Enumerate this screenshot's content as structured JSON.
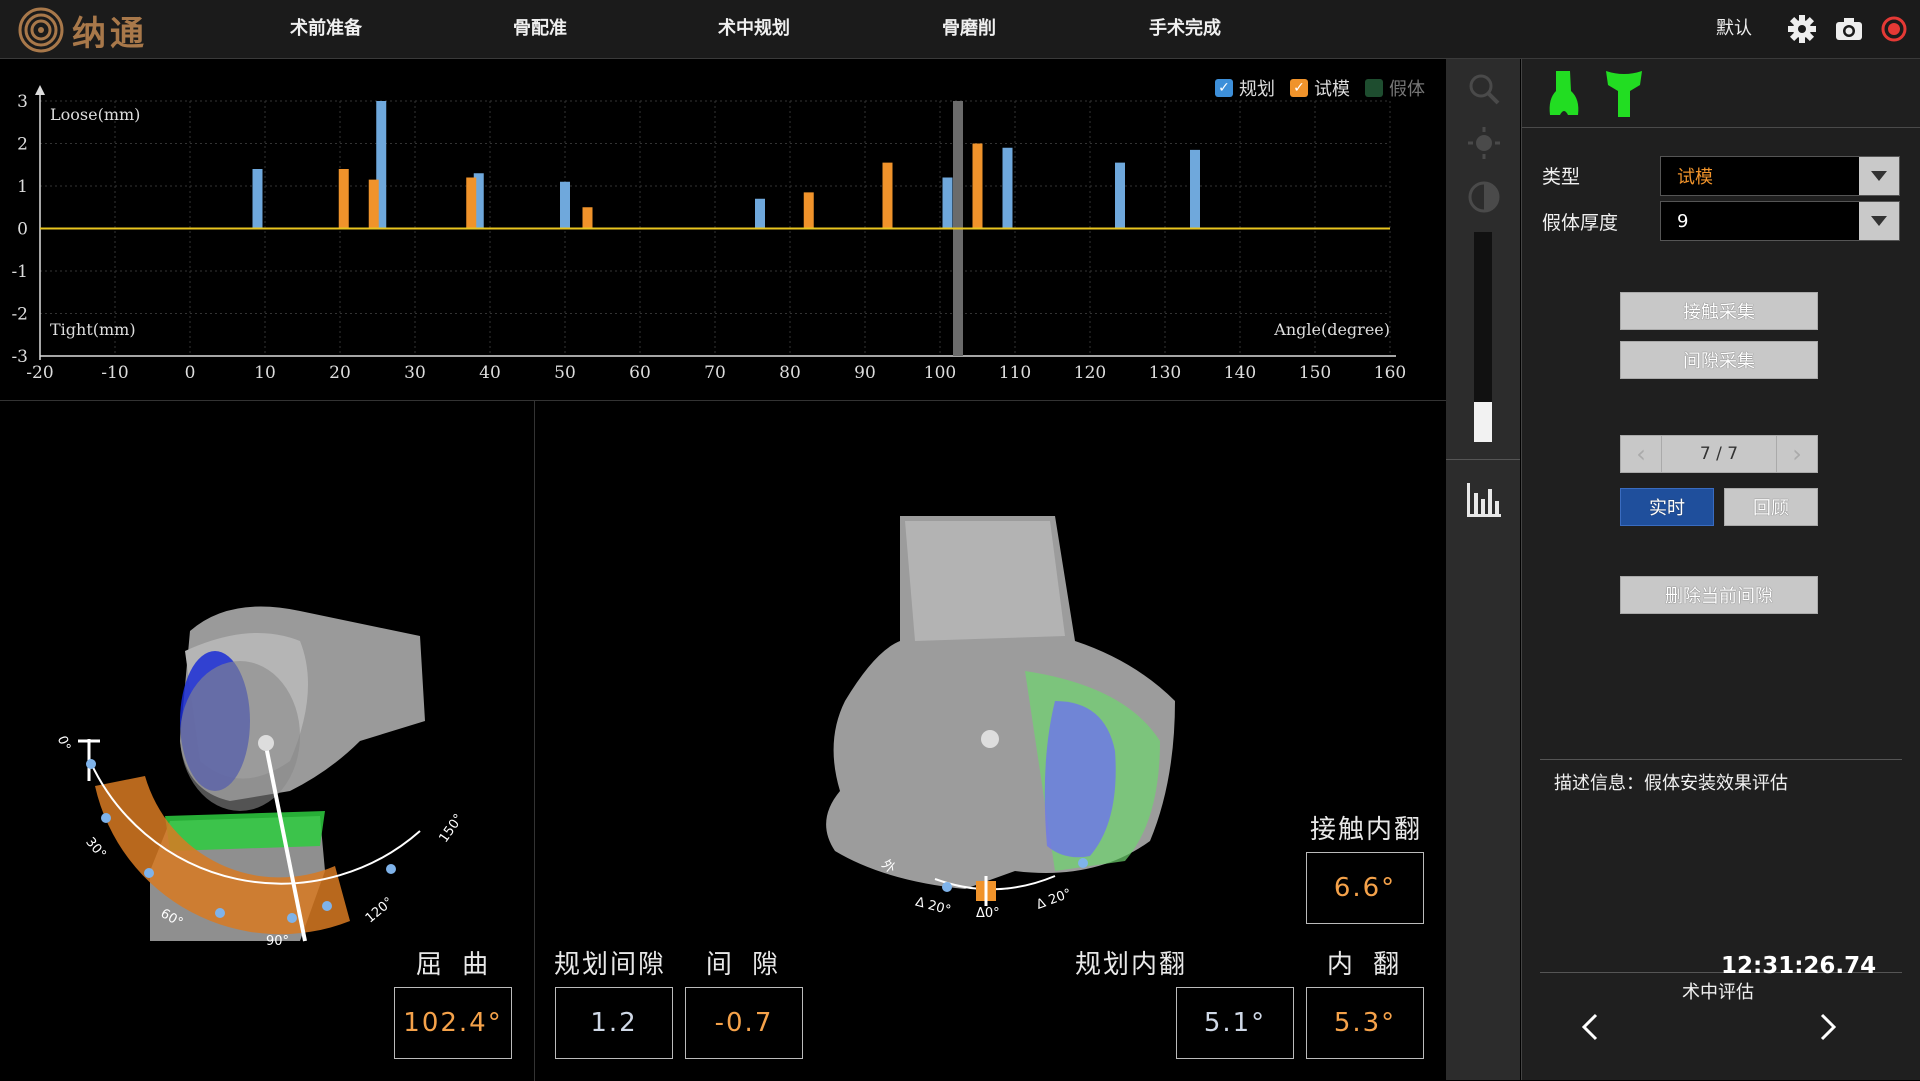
{
  "app": {
    "brand": "纳通"
  },
  "nav": {
    "items": [
      "术前准备",
      "骨配准",
      "术中规划",
      "骨磨削",
      "手术完成"
    ]
  },
  "user": "默认",
  "legend": {
    "plan": "规划",
    "trial": "试模",
    "prosthesis": "假体"
  },
  "colors": {
    "plan": "#6fa8dc",
    "trial": "#f0932b",
    "zero_line": "#e8c51f",
    "accent_orange": "#f5a24a",
    "green_icon": "#22dd22"
  },
  "chart_data": {
    "type": "bar",
    "title": "",
    "top_label": "Loose(mm)",
    "bottom_label": "Tight(mm)",
    "xlabel": "Angle(degree)",
    "xlim": [
      -20,
      160
    ],
    "ylim": [
      -3,
      3
    ],
    "xticks": [
      -20,
      -10,
      0,
      10,
      20,
      30,
      40,
      50,
      60,
      70,
      80,
      90,
      100,
      110,
      120,
      130,
      140,
      150,
      160
    ],
    "yticks": [
      -3,
      -2,
      -1,
      0,
      1,
      2,
      3
    ],
    "grid": true,
    "series": [
      {
        "name": "规划",
        "points": [
          [
            9,
            1.4
          ],
          [
            25.5,
            3.0
          ],
          [
            38.5,
            1.3
          ],
          [
            50,
            1.1
          ],
          [
            76,
            0.7
          ],
          [
            101,
            1.2
          ],
          [
            109,
            1.9
          ],
          [
            124,
            1.55
          ],
          [
            134,
            1.85
          ]
        ]
      },
      {
        "name": "试模",
        "points": [
          [
            20.5,
            1.4
          ],
          [
            24.5,
            1.15
          ],
          [
            37.5,
            1.2
          ],
          [
            53,
            0.5
          ],
          [
            82.5,
            0.85
          ],
          [
            93,
            1.55
          ],
          [
            105,
            2.0
          ]
        ]
      }
    ],
    "current_angle": 102.4
  },
  "left_view": {
    "flexion_label": "屈 曲",
    "flexion_value": "102.4°",
    "dial_labels": [
      "0°",
      "30°",
      "60°",
      "90°",
      "120°",
      "150°"
    ]
  },
  "center_view": {
    "planned_gap_label": "规划间隙",
    "planned_gap_value": "1.2",
    "gap_label": "间 隙",
    "gap_value": "-0.7",
    "planned_varus_label": "规划内翻",
    "planned_varus_value": "5.1°",
    "varus_label": "内 翻",
    "varus_value": "5.3°",
    "contact_varus_label": "接触内翻",
    "contact_varus_value": "6.6°",
    "arc_labels": [
      "外",
      "Δ 20°",
      "Δ0°",
      "Δ 20°"
    ]
  },
  "right_panel": {
    "type_label": "类型",
    "type_value": "试模",
    "thickness_label": "假体厚度",
    "thickness_value": "9",
    "contact_collect": "接触采集",
    "gap_collect": "间隙采集",
    "pager": "7 / 7",
    "realtime": "实时",
    "review": "回顾",
    "delete_gap": "删除当前间隙",
    "description": "描述信息：假体安装效果评估",
    "time": "12:31:26.74",
    "footer_title": "术中评估"
  }
}
